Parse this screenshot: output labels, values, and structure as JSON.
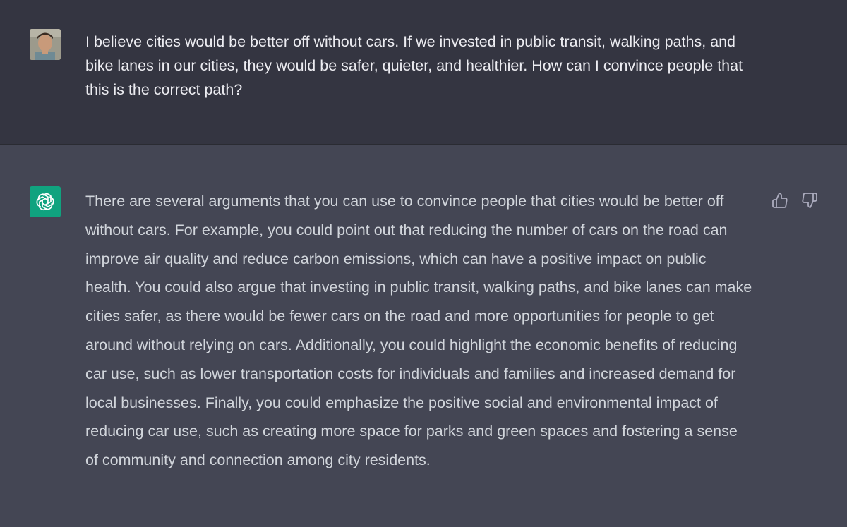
{
  "conversation": {
    "user_message": "I believe cities would be better off without cars. If we invested in public transit, walking paths, and bike lanes in our cities, they would be safer, quieter, and healthier. How can I convince people that this is the correct path?",
    "assistant_message": "There are several arguments that you can use to convince people that cities would be better off without cars. For example, you could point out that reducing the number of cars on the road can improve air quality and reduce carbon emissions, which can have a positive impact on public health. You could also argue that investing in public transit, walking paths, and bike lanes can make cities safer, as there would be fewer cars on the road and more opportunities for people to get around without relying on cars. Additionally, you could highlight the economic benefits of reducing car use, such as lower transportation costs for individuals and families and increased demand for local businesses. Finally, you could emphasize the positive social and environmental impact of reducing car use, such as creating more space for parks and green spaces and fostering a sense of community and connection among city residents."
  },
  "icons": {
    "user_avatar": "user-avatar",
    "assistant_avatar": "openai-logo-icon",
    "thumbs_up": "thumbs-up-icon",
    "thumbs_down": "thumbs-down-icon"
  },
  "colors": {
    "user_bg": "#343541",
    "assistant_bg": "#444654",
    "logo_bg": "#10a37f"
  }
}
